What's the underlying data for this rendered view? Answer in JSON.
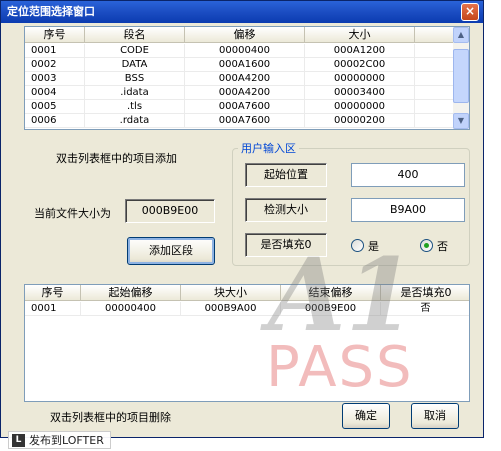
{
  "window": {
    "title": "定位范围选择窗口",
    "close_glyph": "×"
  },
  "segment_table": {
    "columns": [
      "序号",
      "段名",
      "偏移",
      "大小"
    ],
    "rows": [
      [
        "0001",
        "CODE",
        "00000400",
        "000A1200"
      ],
      [
        "0002",
        "DATA",
        "000A1600",
        "00002C00"
      ],
      [
        "0003",
        "BSS",
        "000A4200",
        "00000000"
      ],
      [
        "0004",
        ".idata",
        "000A4200",
        "00003400"
      ],
      [
        "0005",
        ".tls",
        "000A7600",
        "00000000"
      ],
      [
        "0006",
        ".rdata",
        "000A7600",
        "00000200"
      ]
    ]
  },
  "hint_add": "双击列表框中的项目添加",
  "file_size": {
    "label": "当前文件大小为",
    "value": "000B9E00"
  },
  "add_button": "添加区段",
  "user_input": {
    "title": "用户输入区",
    "start_label": "起始位置",
    "start_value": "400",
    "size_label": "检测大小",
    "size_value": "B9A00",
    "fill_label": "是否填充0",
    "yes_label": "是",
    "no_label": "否",
    "selected": "否"
  },
  "range_table": {
    "columns": [
      "序号",
      "起始偏移",
      "块大小",
      "结束偏移",
      "是否填充0"
    ],
    "rows": [
      [
        "0001",
        "00000400",
        "000B9A00",
        "000B9E00",
        "否"
      ]
    ]
  },
  "hint_delete": "双击列表框中的项目删除",
  "ok_button": "确定",
  "cancel_button": "取消",
  "watermark": {
    "line1": "A1",
    "line2": "PASS"
  },
  "lofter": {
    "logo": "L",
    "text": "发布到LOFTER"
  },
  "scroll": {
    "up": "▲",
    "down": "▼"
  }
}
